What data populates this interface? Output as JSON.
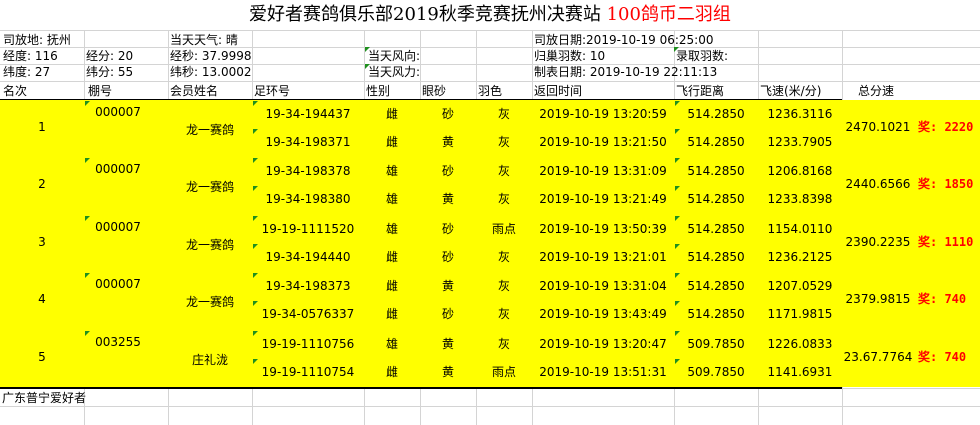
{
  "title": {
    "main": "爱好者赛鸽俱乐部2019秋季竞赛抚州决赛站 ",
    "highlight": "100鸽币二羽组"
  },
  "info": {
    "release_place": "司放地: 抚州",
    "weather": "当天天气: 晴",
    "release_date": "司放日期:2019-10-19 06:25:00",
    "lon_deg": "经度: 116",
    "lon_min": "经分: 20",
    "lon_sec": "经秒: 37.9998",
    "wind_dir": "当天风向:",
    "home_count": "归巢羽数: 10",
    "recorded": "录取羽数:",
    "lat_deg": "纬度: 27",
    "lat_min": "纬分: 55",
    "lat_sec": "纬秒: 13.0002",
    "wind_force": "当天风力:",
    "made_date": "制表日期: 2019-10-19 22:11:13"
  },
  "headers": {
    "rank": "名次",
    "loft": "棚号",
    "member": "会员姓名",
    "ring": "足环号",
    "sex": "性别",
    "eye": "眼砂",
    "color": "羽色",
    "return": "返回时间",
    "distance": "飞行距离",
    "speed": "飞速(米/分)",
    "total": "总分速"
  },
  "groups": [
    {
      "rank": "1",
      "loft": "000007",
      "member": "龙一赛鸽",
      "total": "2470.1021",
      "prize": "奖: 2220",
      "birds": [
        {
          "ring": "19-34-194437",
          "sex": "雌",
          "eye": "砂",
          "color": "灰",
          "return": "2019-10-19 13:20:59",
          "distance": "514.2850",
          "speed": "1236.3116"
        },
        {
          "ring": "19-34-198371",
          "sex": "雌",
          "eye": "黄",
          "color": "灰",
          "return": "2019-10-19 13:21:50",
          "distance": "514.2850",
          "speed": "1233.7905"
        }
      ]
    },
    {
      "rank": "2",
      "loft": "000007",
      "member": "龙一赛鸽",
      "total": "2440.6566",
      "prize": "奖: 1850",
      "birds": [
        {
          "ring": "19-34-198378",
          "sex": "雄",
          "eye": "砂",
          "color": "灰",
          "return": "2019-10-19 13:31:09",
          "distance": "514.2850",
          "speed": "1206.8168"
        },
        {
          "ring": "19-34-198380",
          "sex": "雄",
          "eye": "黄",
          "color": "灰",
          "return": "2019-10-19 13:21:49",
          "distance": "514.2850",
          "speed": "1233.8398"
        }
      ]
    },
    {
      "rank": "3",
      "loft": "000007",
      "member": "龙一赛鸽",
      "total": "2390.2235",
      "prize": "奖: 1110",
      "birds": [
        {
          "ring": "19-19-1111520",
          "sex": "雄",
          "eye": "砂",
          "color": "雨点",
          "return": "2019-10-19 13:50:39",
          "distance": "514.2850",
          "speed": "1154.0110"
        },
        {
          "ring": "19-34-194440",
          "sex": "雌",
          "eye": "砂",
          "color": "灰",
          "return": "2019-10-19 13:21:01",
          "distance": "514.2850",
          "speed": "1236.2125"
        }
      ]
    },
    {
      "rank": "4",
      "loft": "000007",
      "member": "龙一赛鸽",
      "total": "2379.9815",
      "prize": "奖: 740",
      "birds": [
        {
          "ring": "19-34-198373",
          "sex": "雌",
          "eye": "黄",
          "color": "灰",
          "return": "2019-10-19 13:31:04",
          "distance": "514.2850",
          "speed": "1207.0529"
        },
        {
          "ring": "19-34-0576337",
          "sex": "雌",
          "eye": "砂",
          "color": "灰",
          "return": "2019-10-19 13:43:49",
          "distance": "514.2850",
          "speed": "1171.9815"
        }
      ]
    },
    {
      "rank": "5",
      "loft": "003255",
      "member": "庄礼泷",
      "total": "23.67.7764",
      "prize": "奖: 740",
      "birds": [
        {
          "ring": "19-19-1110756",
          "sex": "雄",
          "eye": "黄",
          "color": "灰",
          "return": "2019-10-19 13:20:47",
          "distance": "509.7850",
          "speed": "1226.0833"
        },
        {
          "ring": "19-19-1110754",
          "sex": "雌",
          "eye": "黄",
          "color": "雨点",
          "return": "2019-10-19 13:51:31",
          "distance": "509.7850",
          "speed": "1141.6931"
        }
      ]
    }
  ],
  "footer": "广东普宁爱好者"
}
